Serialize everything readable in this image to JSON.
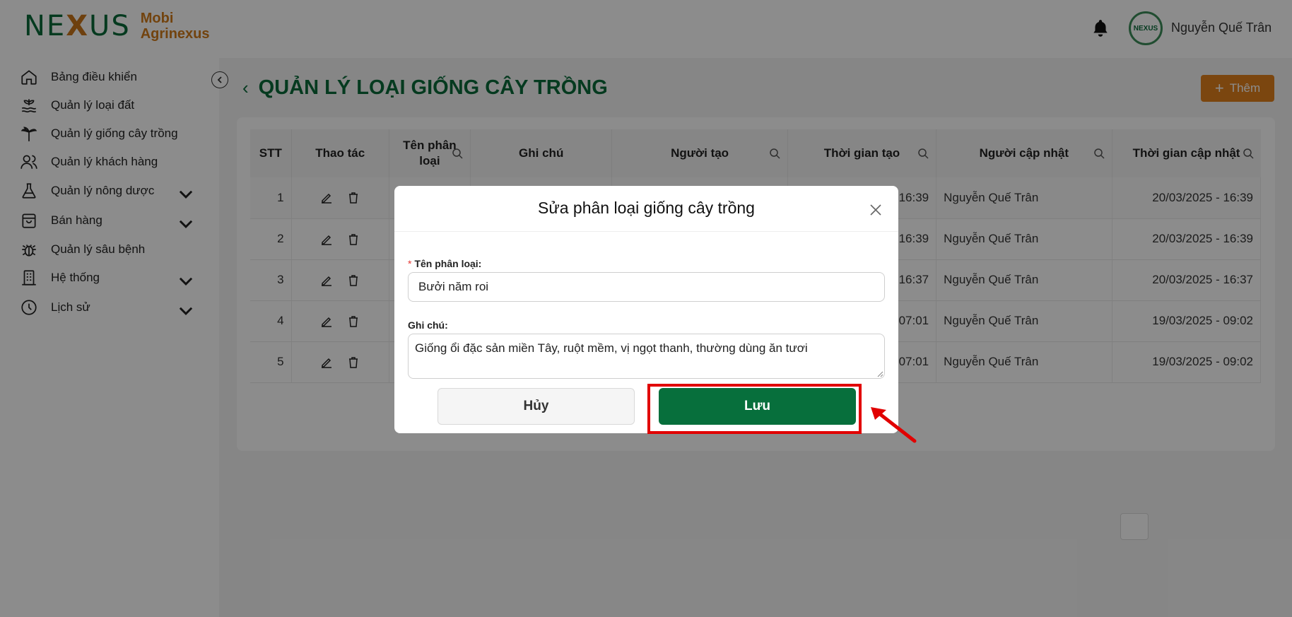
{
  "header": {
    "logo_mark_left": "NE",
    "logo_mark_x": "X",
    "logo_mark_right": "US",
    "logo_line1": "Mobi",
    "logo_line2": "Agrinexus",
    "avatar_text": "NEXUS",
    "username": "Nguyễn Quế Trân"
  },
  "sidebar": {
    "items": [
      {
        "label": "Bảng điều khiển",
        "icon": "home-icon",
        "has_children": false
      },
      {
        "label": "Quản lý loại đất",
        "icon": "soil-icon",
        "has_children": false
      },
      {
        "label": "Quản lý giống cây trồng",
        "icon": "plant-icon",
        "has_children": false
      },
      {
        "label": "Quản lý khách hàng",
        "icon": "users-icon",
        "has_children": false
      },
      {
        "label": "Quản lý nông dược",
        "icon": "flask-icon",
        "has_children": true
      },
      {
        "label": "Bán hàng",
        "icon": "bag-icon",
        "has_children": true
      },
      {
        "label": "Quản lý sâu bệnh",
        "icon": "bug-icon",
        "has_children": false
      },
      {
        "label": "Hệ thống",
        "icon": "building-icon",
        "has_children": true
      },
      {
        "label": "Lịch sử",
        "icon": "clock-icon",
        "has_children": true
      }
    ]
  },
  "main": {
    "title": "QUẢN LÝ LOẠI GIỐNG CÂY TRỒNG",
    "back_glyph": "‹",
    "add_label": "Thêm",
    "table": {
      "headers": [
        "STT",
        "Thao tác",
        "Tên phân loại",
        "Ghi chú",
        "Người tạo",
        "Thời gian tạo",
        "Người cập nhật",
        "Thời gian cập nhật"
      ],
      "rows": [
        {
          "stt": "1",
          "created_time": "16:39",
          "updater": "Nguyễn Quế Trân",
          "updated_time": "20/03/2025 - 16:39"
        },
        {
          "stt": "2",
          "created_time": "16:39",
          "updater": "Nguyễn Quế Trân",
          "updated_time": "20/03/2025 - 16:39"
        },
        {
          "stt": "3",
          "created_time": "16:37",
          "updater": "Nguyễn Quế Trân",
          "updated_time": "20/03/2025 - 16:37"
        },
        {
          "stt": "4",
          "created_time": "07:01",
          "updater": "Nguyễn Quế Trân",
          "updated_time": "19/03/2025 - 09:02"
        },
        {
          "stt": "5",
          "created_time": "07:01",
          "updater": "Nguyễn Quế Trân",
          "updated_time": "19/03/2025 - 09:02"
        }
      ]
    }
  },
  "modal": {
    "title": "Sửa phân loại giống cây trồng",
    "name_label": "Tên phân loại:",
    "required_mark": "*",
    "name_value": "Bưởi năm roi",
    "note_label": "Ghi chú:",
    "note_value": "Giống ổi đặc sản miền Tây, ruột mềm, vị ngọt thanh, thường dùng ăn tươi",
    "cancel_label": "Hủy",
    "save_label": "Lưu"
  },
  "colors": {
    "brand_green": "#076f3c",
    "accent_orange": "#e0801c",
    "annotation_red": "#e10000"
  }
}
